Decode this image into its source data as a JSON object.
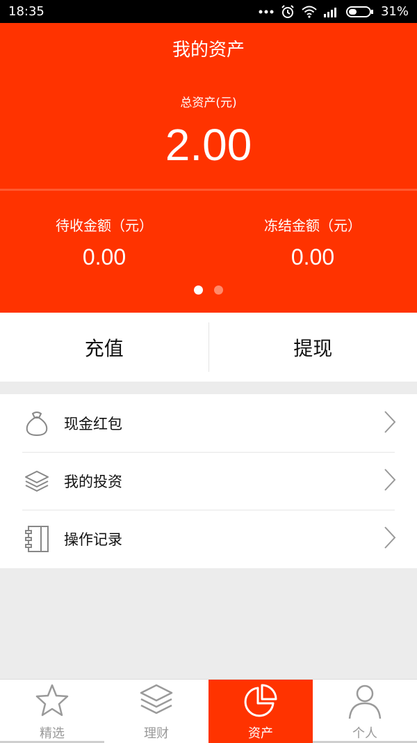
{
  "status_bar": {
    "time": "18:35",
    "battery_percent": "31%"
  },
  "header": {
    "title": "我的资产",
    "total_label": "总资产(元)",
    "total_value": "2.00",
    "pending_label": "待收金额（元）",
    "pending_value": "0.00",
    "frozen_label": "冻结金额（元）",
    "frozen_value": "0.00",
    "page_indicator": {
      "count": 2,
      "active_index": 0
    }
  },
  "actions": {
    "recharge_label": "充值",
    "withdraw_label": "提现"
  },
  "menu": {
    "items": [
      {
        "label": "现金红包",
        "icon": "money-bag-icon"
      },
      {
        "label": "我的投资",
        "icon": "layers-icon"
      },
      {
        "label": "操作记录",
        "icon": "notebook-icon"
      }
    ]
  },
  "tabbar": {
    "tabs": [
      {
        "label": "精选",
        "icon": "star-icon",
        "active": false
      },
      {
        "label": "理财",
        "icon": "layers-icon",
        "active": false
      },
      {
        "label": "资产",
        "icon": "pie-chart-icon",
        "active": true
      },
      {
        "label": "个人",
        "icon": "person-icon",
        "active": false
      }
    ]
  },
  "colors": {
    "accent": "#ff3300",
    "background": "#ececec"
  }
}
